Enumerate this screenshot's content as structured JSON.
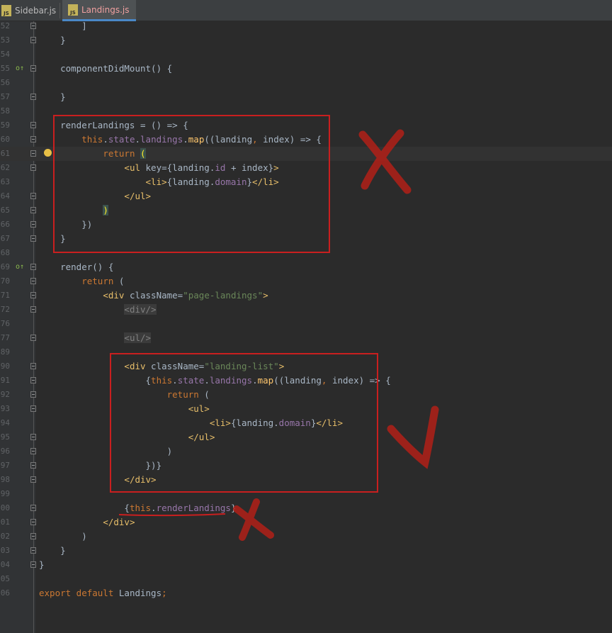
{
  "tabs": [
    {
      "label": "Sidebar.js",
      "icon_text": "JS",
      "active": false
    },
    {
      "label": "Landings.js",
      "icon_text": "JS",
      "active": true
    }
  ],
  "lines": [
    {
      "num": "52",
      "tokens": [
        {
          "t": "        ]",
          "c": ""
        }
      ]
    },
    {
      "num": "53",
      "tokens": [
        {
          "t": "    }",
          "c": ""
        }
      ]
    },
    {
      "num": "54",
      "tokens": []
    },
    {
      "num": "55",
      "tokens": [
        {
          "t": "    componentDidMount() {",
          "c": ""
        }
      ],
      "mark": "o↑"
    },
    {
      "num": "56",
      "tokens": []
    },
    {
      "num": "57",
      "tokens": [
        {
          "t": "    }",
          "c": ""
        }
      ]
    },
    {
      "num": "58",
      "tokens": []
    },
    {
      "num": "59",
      "tokens": [
        {
          "t": "    renderLandings = () => {",
          "c": ""
        }
      ]
    },
    {
      "num": "60",
      "tokens": [
        {
          "t": "        ",
          "c": ""
        },
        {
          "t": "this",
          "c": "k"
        },
        {
          "t": ".",
          "c": ""
        },
        {
          "t": "state",
          "c": "p"
        },
        {
          "t": ".",
          "c": ""
        },
        {
          "t": "landings",
          "c": "p"
        },
        {
          "t": ".",
          "c": ""
        },
        {
          "t": "map",
          "c": "f"
        },
        {
          "t": "((landing",
          "c": ""
        },
        {
          "t": ",",
          "c": "k"
        },
        {
          "t": " index) => {",
          "c": ""
        }
      ]
    },
    {
      "num": "61",
      "tokens": [
        {
          "t": "            ",
          "c": ""
        },
        {
          "t": "return",
          "c": "k"
        },
        {
          "t": " ",
          "c": ""
        },
        {
          "t": "(",
          "c": "paren"
        }
      ],
      "current": true
    },
    {
      "num": "62",
      "tokens": [
        {
          "t": "                ",
          "c": ""
        },
        {
          "t": "<ul",
          "c": "t"
        },
        {
          "t": " key={landing.",
          "c": ""
        },
        {
          "t": "id",
          "c": "p"
        },
        {
          "t": " + index}",
          "c": ""
        },
        {
          "t": ">",
          "c": "t"
        }
      ]
    },
    {
      "num": "63",
      "tokens": [
        {
          "t": "                    ",
          "c": ""
        },
        {
          "t": "<li>",
          "c": "t"
        },
        {
          "t": "{landing.",
          "c": ""
        },
        {
          "t": "domain",
          "c": "p"
        },
        {
          "t": "}",
          "c": ""
        },
        {
          "t": "</li>",
          "c": "t"
        }
      ]
    },
    {
      "num": "64",
      "tokens": [
        {
          "t": "                ",
          "c": ""
        },
        {
          "t": "</ul>",
          "c": "t"
        }
      ]
    },
    {
      "num": "65",
      "tokens": [
        {
          "t": "            ",
          "c": ""
        },
        {
          "t": ")",
          "c": "paren"
        }
      ]
    },
    {
      "num": "66",
      "tokens": [
        {
          "t": "        })",
          "c": ""
        }
      ]
    },
    {
      "num": "67",
      "tokens": [
        {
          "t": "    }",
          "c": ""
        }
      ]
    },
    {
      "num": "68",
      "tokens": []
    },
    {
      "num": "69",
      "tokens": [
        {
          "t": "    render() {",
          "c": ""
        }
      ],
      "mark": "o↑"
    },
    {
      "num": "70",
      "tokens": [
        {
          "t": "        ",
          "c": ""
        },
        {
          "t": "return",
          "c": "k"
        },
        {
          "t": " (",
          "c": ""
        }
      ]
    },
    {
      "num": "71",
      "tokens": [
        {
          "t": "            ",
          "c": ""
        },
        {
          "t": "<div",
          "c": "t"
        },
        {
          "t": " className=",
          "c": ""
        },
        {
          "t": "\"page-landings\"",
          "c": "s"
        },
        {
          "t": ">",
          "c": "t"
        }
      ]
    },
    {
      "num": "72",
      "tokens": [
        {
          "t": "                ",
          "c": ""
        },
        {
          "t": "<div/>",
          "c": "d"
        }
      ]
    },
    {
      "num": "76",
      "tokens": []
    },
    {
      "num": "77",
      "tokens": [
        {
          "t": "                ",
          "c": ""
        },
        {
          "t": "<ul/>",
          "c": "d"
        }
      ]
    },
    {
      "num": "89",
      "tokens": []
    },
    {
      "num": "90",
      "tokens": [
        {
          "t": "                ",
          "c": ""
        },
        {
          "t": "<div",
          "c": "t"
        },
        {
          "t": " className=",
          "c": ""
        },
        {
          "t": "\"landing-list\"",
          "c": "s"
        },
        {
          "t": ">",
          "c": "t"
        }
      ]
    },
    {
      "num": "91",
      "tokens": [
        {
          "t": "                    {",
          "c": ""
        },
        {
          "t": "this",
          "c": "k"
        },
        {
          "t": ".",
          "c": ""
        },
        {
          "t": "state",
          "c": "p"
        },
        {
          "t": ".",
          "c": ""
        },
        {
          "t": "landings",
          "c": "p"
        },
        {
          "t": ".",
          "c": ""
        },
        {
          "t": "map",
          "c": "f"
        },
        {
          "t": "((landing",
          "c": ""
        },
        {
          "t": ",",
          "c": "k"
        },
        {
          "t": " index) => {",
          "c": ""
        }
      ]
    },
    {
      "num": "92",
      "tokens": [
        {
          "t": "                        ",
          "c": ""
        },
        {
          "t": "return",
          "c": "k"
        },
        {
          "t": " (",
          "c": ""
        }
      ]
    },
    {
      "num": "93",
      "tokens": [
        {
          "t": "                            ",
          "c": ""
        },
        {
          "t": "<ul>",
          "c": "t"
        }
      ]
    },
    {
      "num": "94",
      "tokens": [
        {
          "t": "                                ",
          "c": ""
        },
        {
          "t": "<li>",
          "c": "t"
        },
        {
          "t": "{landing.",
          "c": ""
        },
        {
          "t": "domain",
          "c": "p"
        },
        {
          "t": "}",
          "c": ""
        },
        {
          "t": "</li>",
          "c": "t"
        }
      ]
    },
    {
      "num": "95",
      "tokens": [
        {
          "t": "                            ",
          "c": ""
        },
        {
          "t": "</ul>",
          "c": "t"
        }
      ]
    },
    {
      "num": "96",
      "tokens": [
        {
          "t": "                        )",
          "c": ""
        }
      ]
    },
    {
      "num": "97",
      "tokens": [
        {
          "t": "                    })}",
          "c": ""
        }
      ]
    },
    {
      "num": "98",
      "tokens": [
        {
          "t": "                ",
          "c": ""
        },
        {
          "t": "</div>",
          "c": "t"
        }
      ]
    },
    {
      "num": "99",
      "tokens": []
    },
    {
      "num": "00",
      "tokens": [
        {
          "t": "                {",
          "c": ""
        },
        {
          "t": "this",
          "c": "k"
        },
        {
          "t": ".",
          "c": ""
        },
        {
          "t": "renderLandings",
          "c": "p"
        },
        {
          "t": "}",
          "c": ""
        }
      ]
    },
    {
      "num": "01",
      "tokens": [
        {
          "t": "            ",
          "c": ""
        },
        {
          "t": "</div>",
          "c": "t"
        }
      ]
    },
    {
      "num": "02",
      "tokens": [
        {
          "t": "        )",
          "c": ""
        }
      ]
    },
    {
      "num": "03",
      "tokens": [
        {
          "t": "    }",
          "c": ""
        }
      ]
    },
    {
      "num": "04",
      "tokens": [
        {
          "t": "}",
          "c": ""
        }
      ]
    },
    {
      "num": "05",
      "tokens": []
    },
    {
      "num": "06",
      "tokens": [
        {
          "t": "export default ",
          "c": "k"
        },
        {
          "t": "Landings",
          "c": ""
        },
        {
          "t": ";",
          "c": "k"
        }
      ]
    }
  ],
  "annotation_color": "#c91f1f"
}
